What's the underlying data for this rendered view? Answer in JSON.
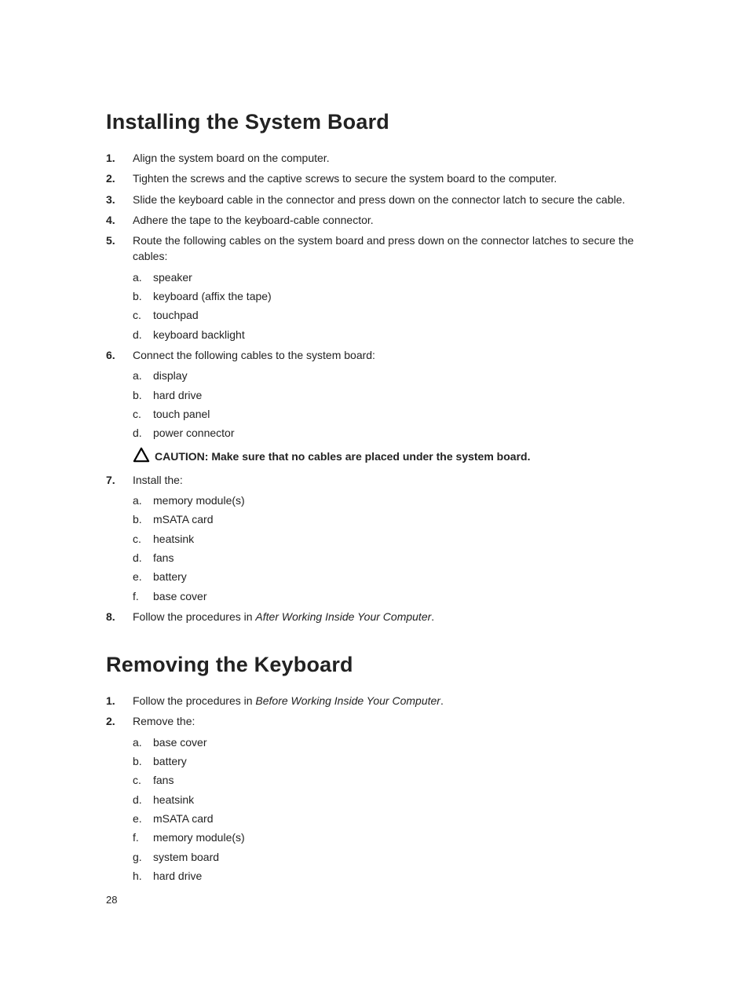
{
  "page_number": "28",
  "sections": {
    "install": {
      "title": "Installing the System Board",
      "steps": {
        "s1": "Align the system board on the computer.",
        "s2": "Tighten the screws and the captive screws to secure the system board to the computer.",
        "s3": "Slide the keyboard cable in the connector and press down on the connector latch to secure the cable.",
        "s4": "Adhere the tape to the keyboard-cable connector.",
        "s5_intro": "Route the following cables on the system board and press down on the connector latches to secure the cables:",
        "s5_items": {
          "a": "speaker",
          "b": "keyboard (affix the tape)",
          "c": "touchpad",
          "d": "keyboard backlight"
        },
        "s6_intro": "Connect the following cables to the system board:",
        "s6_items": {
          "a": "display",
          "b": "hard drive",
          "c": "touch panel",
          "d": "power connector"
        },
        "caution": "CAUTION: Make sure that no cables are placed under the system board.",
        "s7_intro": "Install the:",
        "s7_items": {
          "a": "memory module(s)",
          "b": "mSATA card",
          "c": "heatsink",
          "d": "fans",
          "e": "battery",
          "f": "base cover"
        },
        "s8_prefix": "Follow the procedures in ",
        "s8_italic": "After Working Inside Your Computer",
        "s8_suffix": "."
      }
    },
    "remove": {
      "title": "Removing the Keyboard",
      "steps": {
        "s1_prefix": "Follow the procedures in ",
        "s1_italic": "Before Working Inside Your Computer",
        "s1_suffix": ".",
        "s2_intro": "Remove the:",
        "s2_items": {
          "a": "base cover",
          "b": "battery",
          "c": "fans",
          "d": "heatsink",
          "e": "mSATA card",
          "f": "memory module(s)",
          "g": "system board",
          "h": "hard drive"
        }
      }
    }
  }
}
